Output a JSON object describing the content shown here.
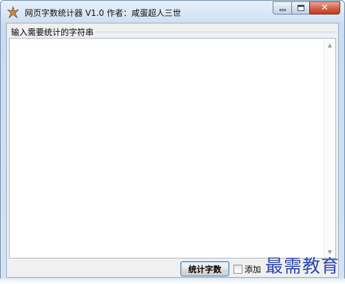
{
  "window": {
    "title": "网页字数统计器 V1.0 作者：咸蛋超人三世",
    "icon": "star-icon",
    "caption_buttons": {
      "minimize_icon": "minimize-icon",
      "maximize_icon": "maximize-icon",
      "close_label": "✕"
    }
  },
  "input_group": {
    "label": "输入需要统计的字符串",
    "value": ""
  },
  "scrollbar": {
    "up_glyph": "▲",
    "down_glyph": "▼"
  },
  "actions": {
    "count_button_label": "统计字数",
    "checkbox_label": "添加",
    "checkbox_checked": false
  },
  "overlay": {
    "watermark_text": "最需教育"
  },
  "colors": {
    "close_button": "#c03a20",
    "watermark": "#2440a8",
    "button_border": "#3c7fb1"
  }
}
